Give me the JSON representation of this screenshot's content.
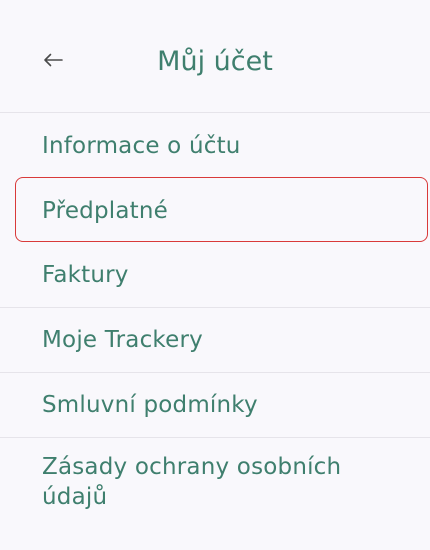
{
  "header": {
    "title": "Můj účet",
    "back_icon": "arrow-left-icon"
  },
  "menu": {
    "items": [
      {
        "label": "Informace o účtu"
      },
      {
        "label": "Předplatné"
      },
      {
        "label": "Faktury"
      },
      {
        "label": "Moje Trackery"
      },
      {
        "label": "Smluvní podmínky"
      },
      {
        "label": "Zásady ochrany osobních údajů"
      }
    ]
  },
  "colors": {
    "accent": "#3f7f6e",
    "background": "#f9f8fc",
    "divider": "#e6e4ea",
    "highlight": "#d93a3a"
  }
}
